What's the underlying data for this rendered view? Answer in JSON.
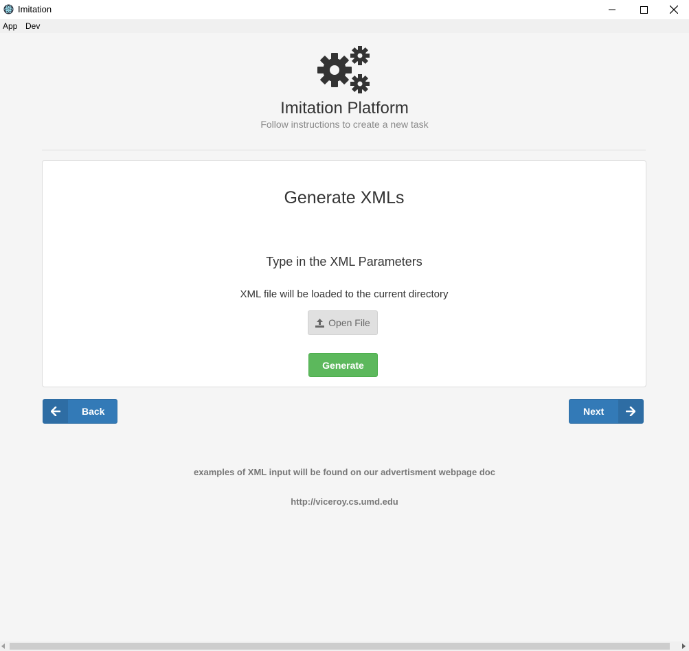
{
  "window": {
    "title": "Imitation"
  },
  "menu": {
    "items": [
      {
        "label": "App"
      },
      {
        "label": "Dev"
      }
    ]
  },
  "header": {
    "icon": "gears-icon",
    "title": "Imitation Platform",
    "subtitle": "Follow instructions to create a new task"
  },
  "panel": {
    "heading": "Generate XMLs",
    "subheading": "Type in the XML Parameters",
    "note": "XML file will be loaded to the current directory",
    "open_file_label": "Open File",
    "generate_label": "Generate"
  },
  "nav": {
    "back_label": "Back",
    "next_label": "Next"
  },
  "footer": {
    "note": "examples of XML input will be found on our advertisment webpage doc",
    "link": "http://viceroy.cs.umd.edu"
  },
  "colors": {
    "primary": "#337ab7",
    "success": "#5cb85c",
    "background": "#f5f5f5"
  }
}
